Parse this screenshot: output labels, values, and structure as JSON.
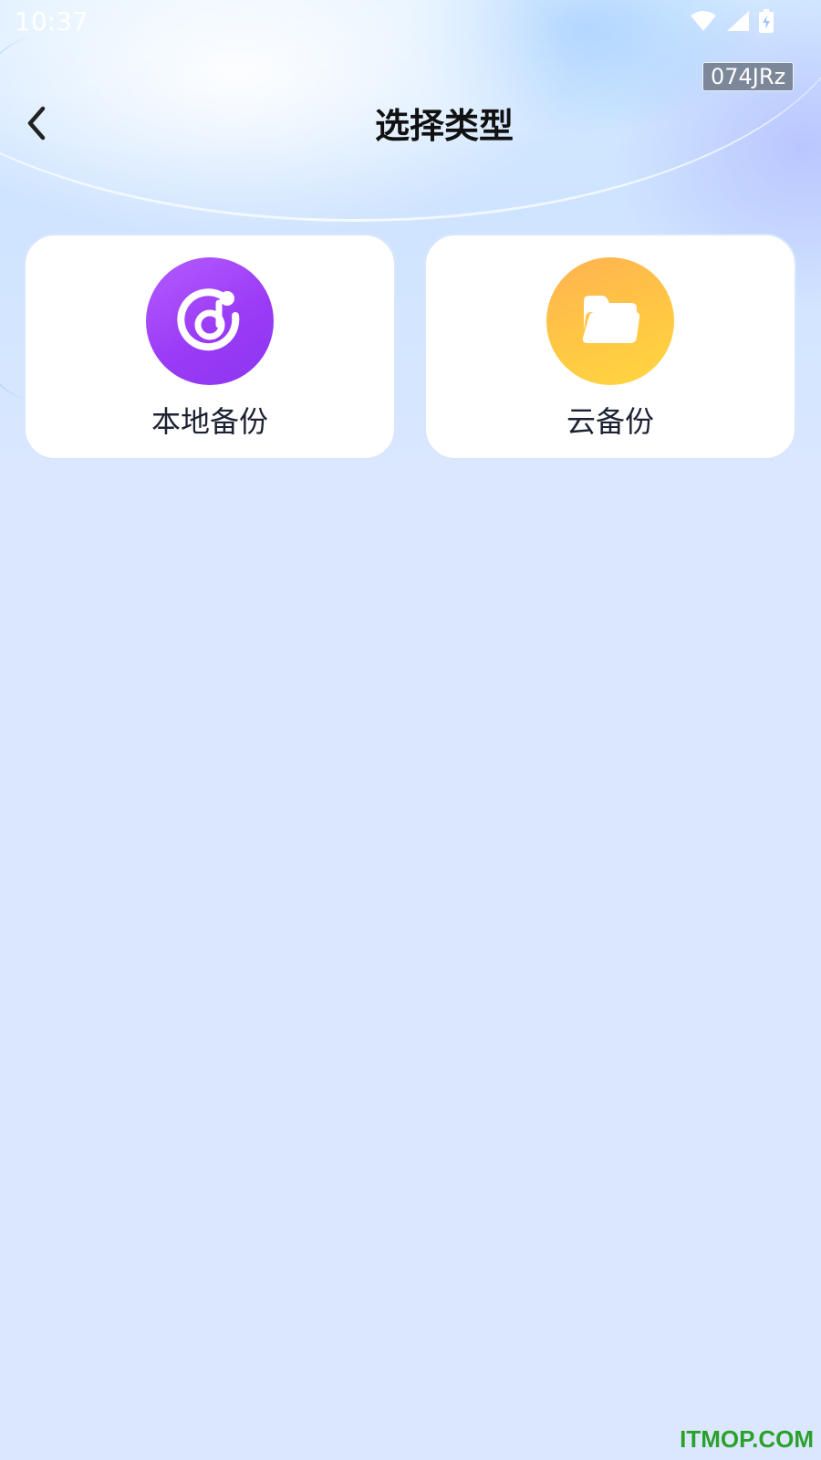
{
  "status_bar": {
    "time": "10:37",
    "icons": [
      "wifi-icon",
      "cell-signal-icon",
      "battery-charging-icon"
    ]
  },
  "badge": "074JRz",
  "header": {
    "back_icon": "chevron-left-icon",
    "title": "选择类型"
  },
  "cards": [
    {
      "label": "本地备份",
      "icon": "music-disc-icon",
      "color": "#a046fb"
    },
    {
      "label": "云备份",
      "icon": "folder-icon",
      "color": "#ffbe48"
    }
  ],
  "watermark": "ITMOP.COM",
  "colors": {
    "background": "#dbe7ff",
    "card": "#ffffff",
    "watermark": "#2aa12a"
  }
}
